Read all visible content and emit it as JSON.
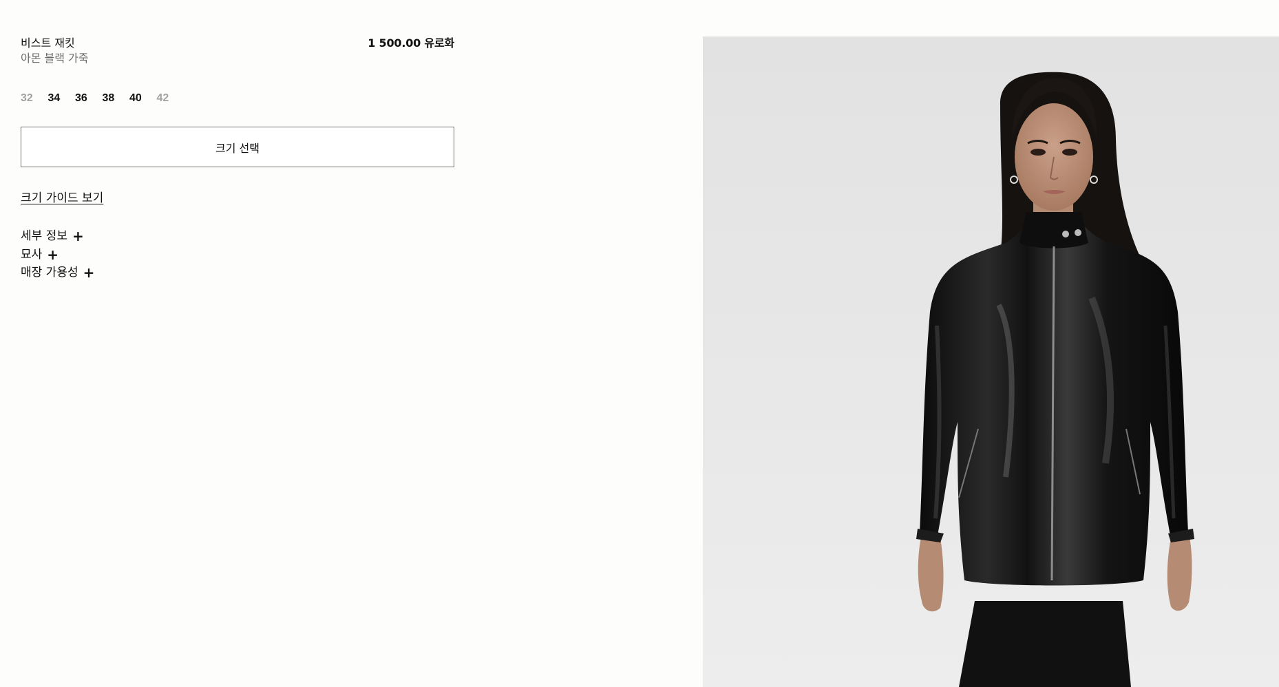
{
  "product": {
    "name": "비스트 재킷",
    "subtitle": "아몬 블랙 가죽",
    "price": "1 500.00 유로화"
  },
  "sizes": [
    {
      "label": "32",
      "available": false
    },
    {
      "label": "34",
      "available": true
    },
    {
      "label": "36",
      "available": true
    },
    {
      "label": "38",
      "available": true
    },
    {
      "label": "40",
      "available": true
    },
    {
      "label": "42",
      "available": false
    }
  ],
  "select_button_label": "크기 선택",
  "size_guide_label": "크기 가이드 보기",
  "accordion": [
    {
      "label": "세부 정보",
      "icon": "plus-icon"
    },
    {
      "label": "묘사",
      "icon": "plus-icon"
    },
    {
      "label": "매장 가용성",
      "icon": "plus-icon"
    }
  ],
  "colors": {
    "background": "#fdfdfb",
    "text": "#111111",
    "muted": "#a3a3a3",
    "image_background": "#e8e8e8"
  }
}
